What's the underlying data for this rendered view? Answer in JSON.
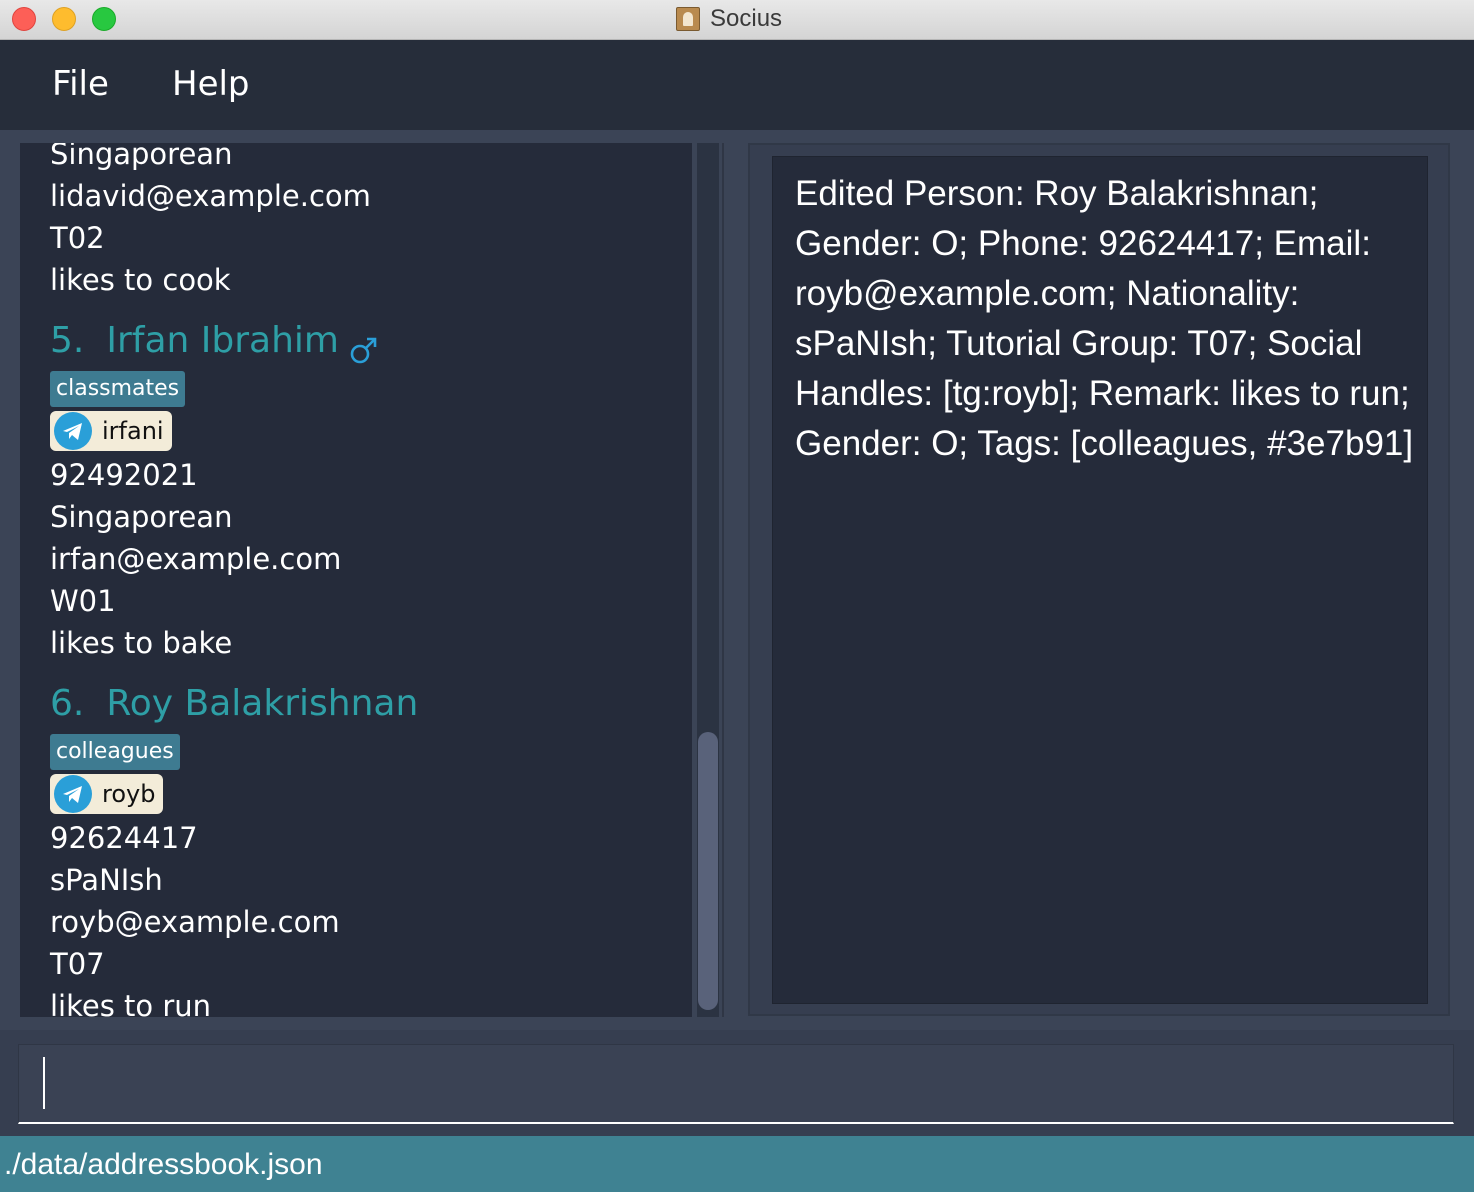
{
  "window": {
    "title": "Socius",
    "app_icon": "address-book-icon"
  },
  "menu": {
    "items": [
      {
        "label": "File"
      },
      {
        "label": "Help"
      }
    ]
  },
  "person_list": {
    "partial_top": {
      "nationality": "Singaporean",
      "email": "lidavid@example.com",
      "tutorial_group": "T02",
      "remark": "likes to cook"
    },
    "persons": [
      {
        "index": "5.",
        "name": "Irfan Ibrahim",
        "gender_icon": "male-symbol-icon",
        "tags": [
          "classmates"
        ],
        "handle": {
          "platform_icon": "telegram-icon",
          "text": "irfani"
        },
        "phone": "92492021",
        "nationality": "Singaporean",
        "email": "irfan@example.com",
        "tutorial_group": "W01",
        "remark": "likes to bake"
      },
      {
        "index": "6.",
        "name": "Roy Balakrishnan",
        "tags": [
          "colleagues"
        ],
        "handle": {
          "platform_icon": "telegram-icon",
          "text": "royb"
        },
        "phone": "92624417",
        "nationality": "sPaNIsh",
        "email": "royb@example.com",
        "tutorial_group": "T07",
        "remark": "likes to run"
      }
    ]
  },
  "result_display": {
    "text": "Edited Person: Roy Balakrishnan; Gender: O; Phone: 92624417; Email: royb@example.com; Nationality: sPaNIsh; Tutorial Group: T07; Social Handles: [tg:royb]; Remark: likes to run; Gender: O; Tags: [colleagues, #3e7b91]"
  },
  "command_box": {
    "value": ""
  },
  "status_bar": {
    "file_path": "./data/addressbook.json"
  },
  "colors": {
    "name_accent": "#2e9fa6",
    "tag_background": "#3e7b91",
    "status_bar": "#3f8292",
    "panel_background": "#252b3a"
  }
}
